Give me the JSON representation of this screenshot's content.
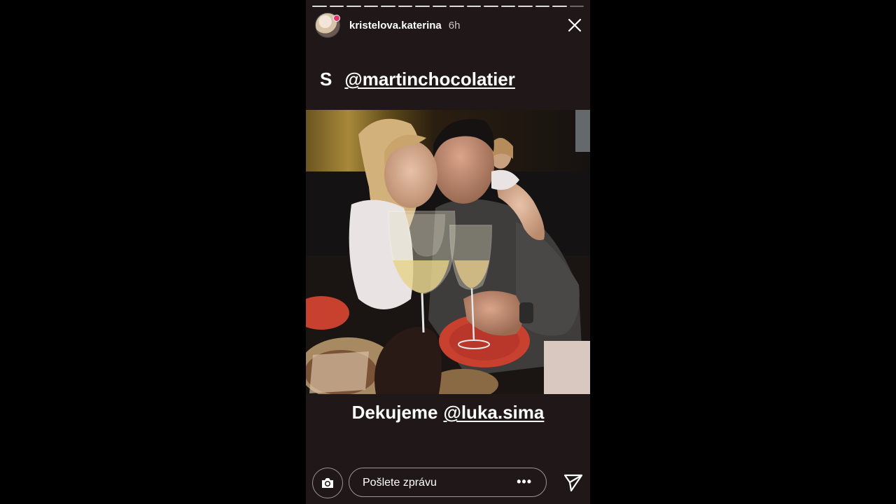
{
  "story": {
    "username": "kristelova.katerina",
    "time": "6h",
    "top_caption_letter": "S",
    "top_caption_mention": "@martinchocolatier",
    "bottom_caption_text": "Dekujeme",
    "bottom_caption_mention": "@luka.sima",
    "progress_segments": 16,
    "active_segment": 15
  },
  "footer": {
    "message_placeholder": "Pošlete zprávu",
    "more_label": "•••"
  },
  "icons": {
    "close": "close-icon",
    "camera": "camera-icon",
    "send": "send-icon",
    "more": "more-icon"
  },
  "colors": {
    "background": "#000000",
    "story_background": "#1f1718",
    "text": "#ffffff",
    "plate_red": "#c8402e"
  }
}
